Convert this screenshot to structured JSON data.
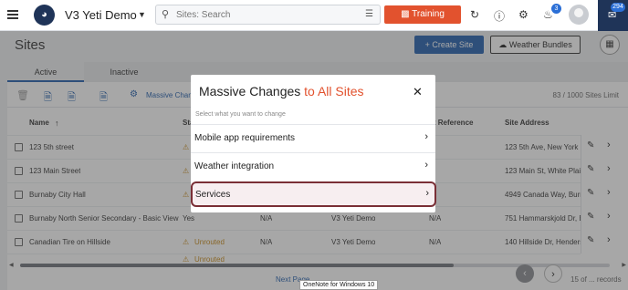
{
  "topbar": {
    "org_name": "V3 Yeti Demo",
    "search_placeholder": "Sites: Search",
    "training_label": "Training",
    "notification_count": "3",
    "chat_count": "294"
  },
  "header": {
    "title": "Sites",
    "create_label": "Create Site",
    "weather_label": "Weather Bundles"
  },
  "tabs": [
    {
      "label": "Active",
      "active": true
    },
    {
      "label": "Inactive",
      "active": false
    }
  ],
  "toolbar": {
    "massive_label": "Massive Changes",
    "limit_text": "83 / 1000 Sites Limit"
  },
  "table": {
    "columns": [
      "Name",
      "Sta",
      "nt Reference",
      "Site Address"
    ],
    "rows": [
      {
        "name": "123 5th street",
        "status": "",
        "reference": "A",
        "address": "123 5th Ave, New York"
      },
      {
        "name": "123 Main Street",
        "status": "",
        "reference": "A",
        "address": "123 Main St, White Plair"
      },
      {
        "name": "Burnaby City Hall",
        "status": "",
        "reference": "A",
        "address": "4949 Canada Way, Burn"
      },
      {
        "name": "Burnaby North Senior Secondary - Basic View",
        "status": "Yes",
        "tracker": "N/A",
        "org": "V3 Yeti Demo",
        "reference": "N/A",
        "address": "751 Hammarskjold Dr, B"
      },
      {
        "name": "Canadian Tire on Hillside",
        "status": "Unrouted",
        "tracker": "N/A",
        "org": "V3 Yeti Demo",
        "reference": "N/A",
        "address": "140 Hillside Dr, Henders"
      },
      {
        "name": "",
        "status": "Unrouted",
        "tracker": "",
        "org": "",
        "reference": "",
        "address": ""
      }
    ]
  },
  "footer": {
    "next_page_label": "Next Page",
    "records_text": "15 of ... records"
  },
  "tooltip_text": "OneNote for Windows 10",
  "modal": {
    "title_main": "Massive Changes",
    "title_accent": "to All Sites",
    "subtitle": "Select what you want to change",
    "options": [
      {
        "label": "Mobile app requirements"
      },
      {
        "label": "Weather integration"
      },
      {
        "label": "Services",
        "selected": true
      }
    ]
  },
  "colors": {
    "brand_navy": "#1f3458",
    "accent_orange": "#e2522e",
    "primary_blue": "#2460ad",
    "selection_border": "#7a2f36"
  }
}
